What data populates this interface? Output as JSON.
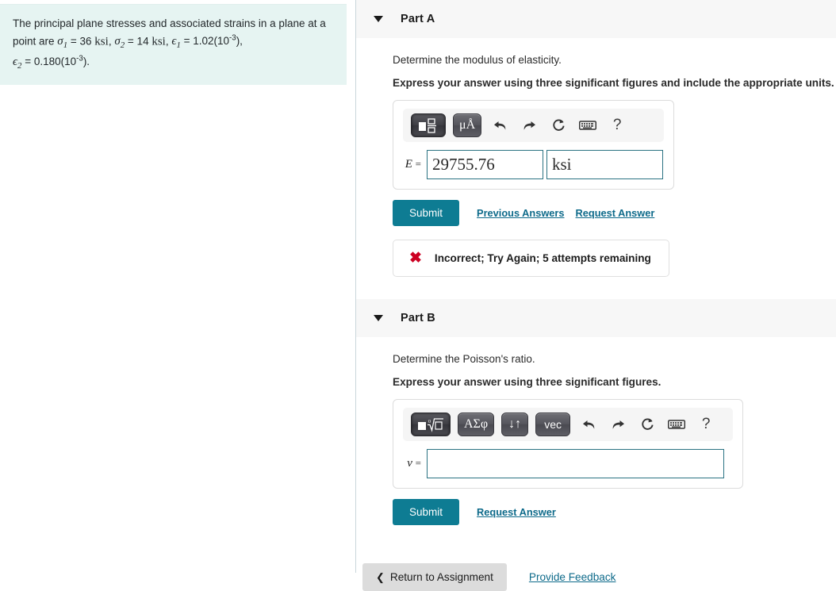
{
  "question": {
    "line1": "The principal plane stresses and associated strains in a plane at a",
    "line2_prefix": "point are ",
    "sigma1_label": "σ",
    "sigma1_sub": "1",
    "sigma1_value": "= 36",
    "sigma1_unit": "ksi",
    "sigma2_label": "σ",
    "sigma2_sub": "2",
    "sigma2_value": "= 14",
    "sigma2_unit": "ksi",
    "eps1_label": "ϵ",
    "eps1_sub": "1",
    "eps1_value": "= 1.02(10",
    "eps1_exp": "-3",
    "eps1_suffix": "),",
    "eps2_label": "ϵ",
    "eps2_sub": "2",
    "eps2_value": "= 0.180(10",
    "eps2_exp": "-3",
    "eps2_suffix": ")."
  },
  "part_a": {
    "title": "Part A",
    "prompt": "Determine the modulus of elasticity.",
    "instruction": "Express your answer using three significant figures and include the appropriate units.",
    "toolbar": {
      "template_button": "▣",
      "units_button": "μÅ",
      "undo": "undo-arrow",
      "redo": "redo-arrow",
      "reset": "reset-arrow",
      "keyboard": "keyboard",
      "help": "?"
    },
    "var_label": "E",
    "equals": "=",
    "answer_value": "29755.76",
    "answer_unit": "ksi",
    "answer_placeholder": "",
    "unit_placeholder": "",
    "submit_label": "Submit",
    "previous_answers_label": "Previous Answers",
    "request_answer_label": "Request Answer",
    "feedback": {
      "icon": "x-mark",
      "text": "Incorrect; Try Again; 5 attempts remaining"
    }
  },
  "part_b": {
    "title": "Part B",
    "prompt": "Determine the Poisson's ratio.",
    "instruction": "Express your answer using three significant figures.",
    "toolbar": {
      "template_button": "▣√▫",
      "greek_button": "ΑΣφ",
      "arrows_button": "↓↑",
      "vec_button": "vec",
      "undo": "undo-arrow",
      "redo": "redo-arrow",
      "reset": "reset-arrow",
      "keyboard": "keyboard",
      "help": "?"
    },
    "var_label": "ν",
    "equals": "=",
    "answer_value": "",
    "answer_placeholder": "",
    "submit_label": "Submit",
    "request_answer_label": "Request Answer"
  },
  "footer": {
    "return_label": "Return to Assignment",
    "chevron": "‹",
    "feedback_label": "Provide Feedback"
  },
  "colors": {
    "question_bg": "#e6f4f2",
    "header_bg": "#f7f7f7",
    "accent": "#0e7c93",
    "link": "#0d6a8a",
    "error": "#cc0022",
    "field_border": "#2b7383"
  }
}
